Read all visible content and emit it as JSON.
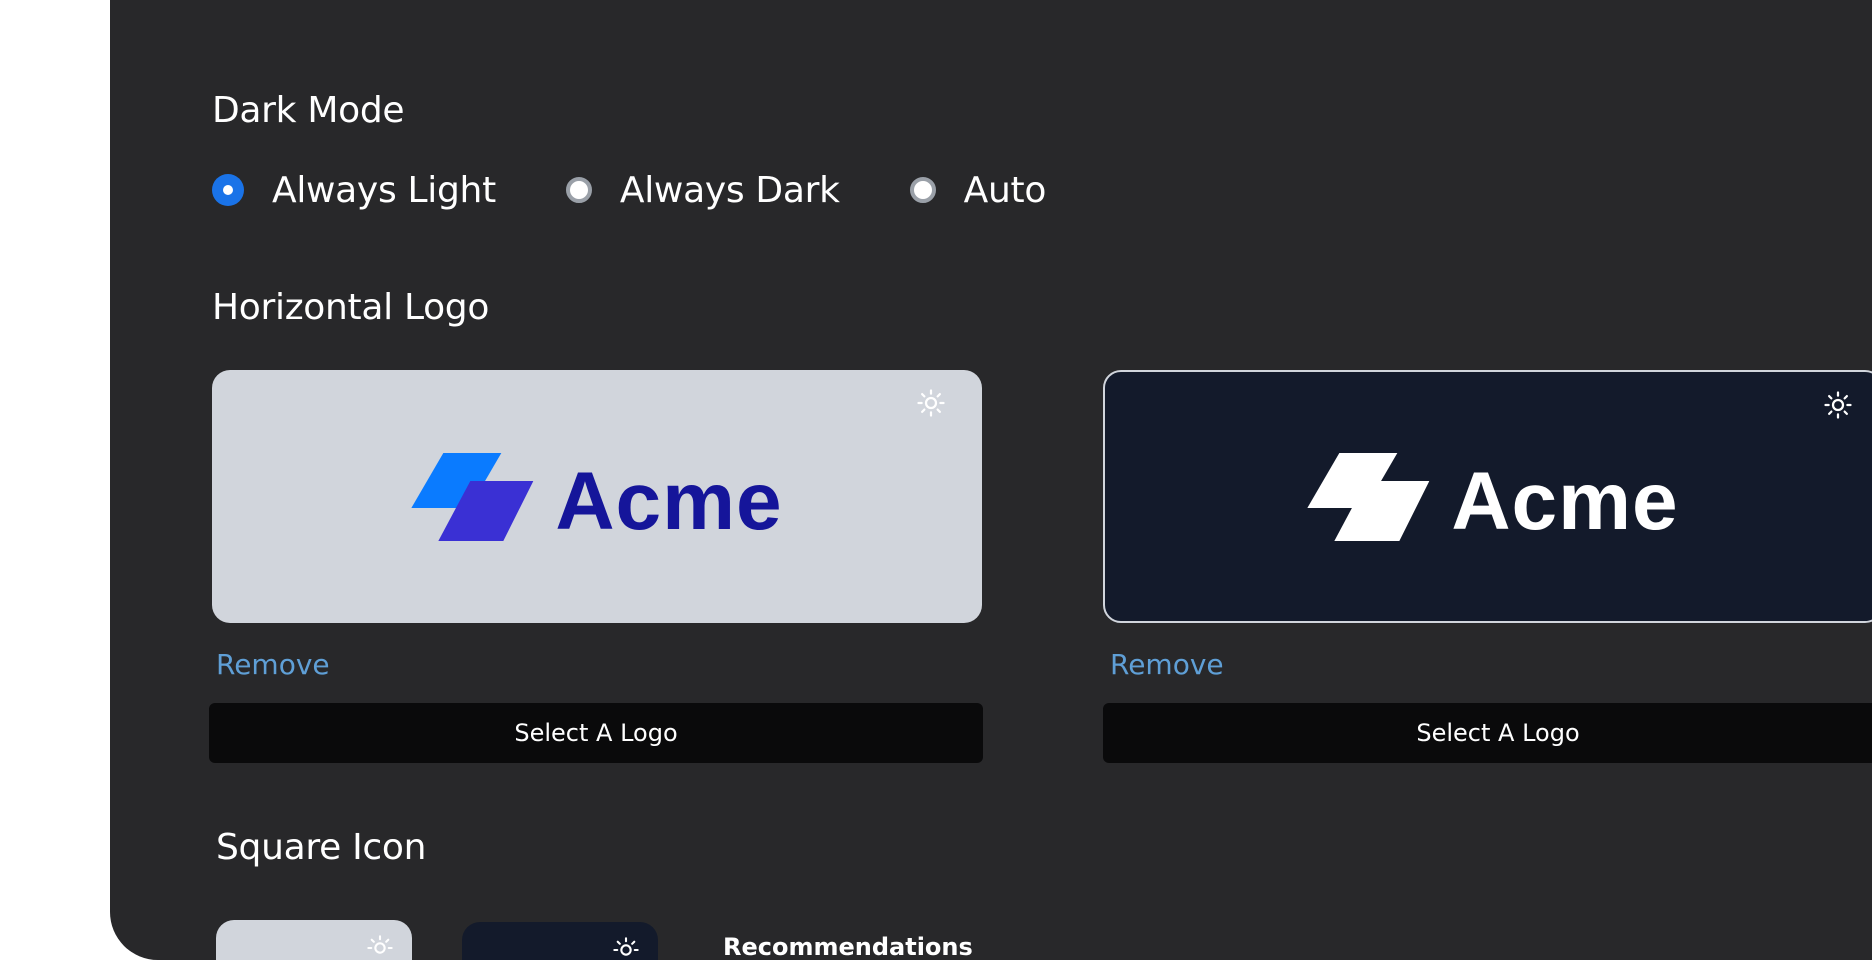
{
  "dark_mode": {
    "title": "Dark Mode",
    "options": [
      {
        "label": "Always Light",
        "selected": true
      },
      {
        "label": "Always Dark",
        "selected": false
      },
      {
        "label": "Auto",
        "selected": false
      }
    ]
  },
  "horizontal_logo": {
    "title": "Horizontal Logo",
    "light": {
      "logo_text": "Acme",
      "remove_label": "Remove",
      "select_label": "Select A Logo",
      "icon": "sun-icon"
    },
    "dark": {
      "logo_text": "Acme",
      "remove_label": "Remove",
      "select_label": "Select A Logo",
      "icon": "sun-icon"
    }
  },
  "square_icon": {
    "title": "Square Icon",
    "recommendations_label": "Recommendations"
  },
  "colors": {
    "panel_bg": "#28282a",
    "accent_blue": "#1a73e8",
    "link_blue": "#5f9fd6",
    "logo_dark_bg": "#131a2b",
    "logo_light_bg": "#d1d5dc",
    "brand_navy": "#15159a",
    "brand_blue": "#0a7bff",
    "brand_indigo": "#3a30d4"
  }
}
